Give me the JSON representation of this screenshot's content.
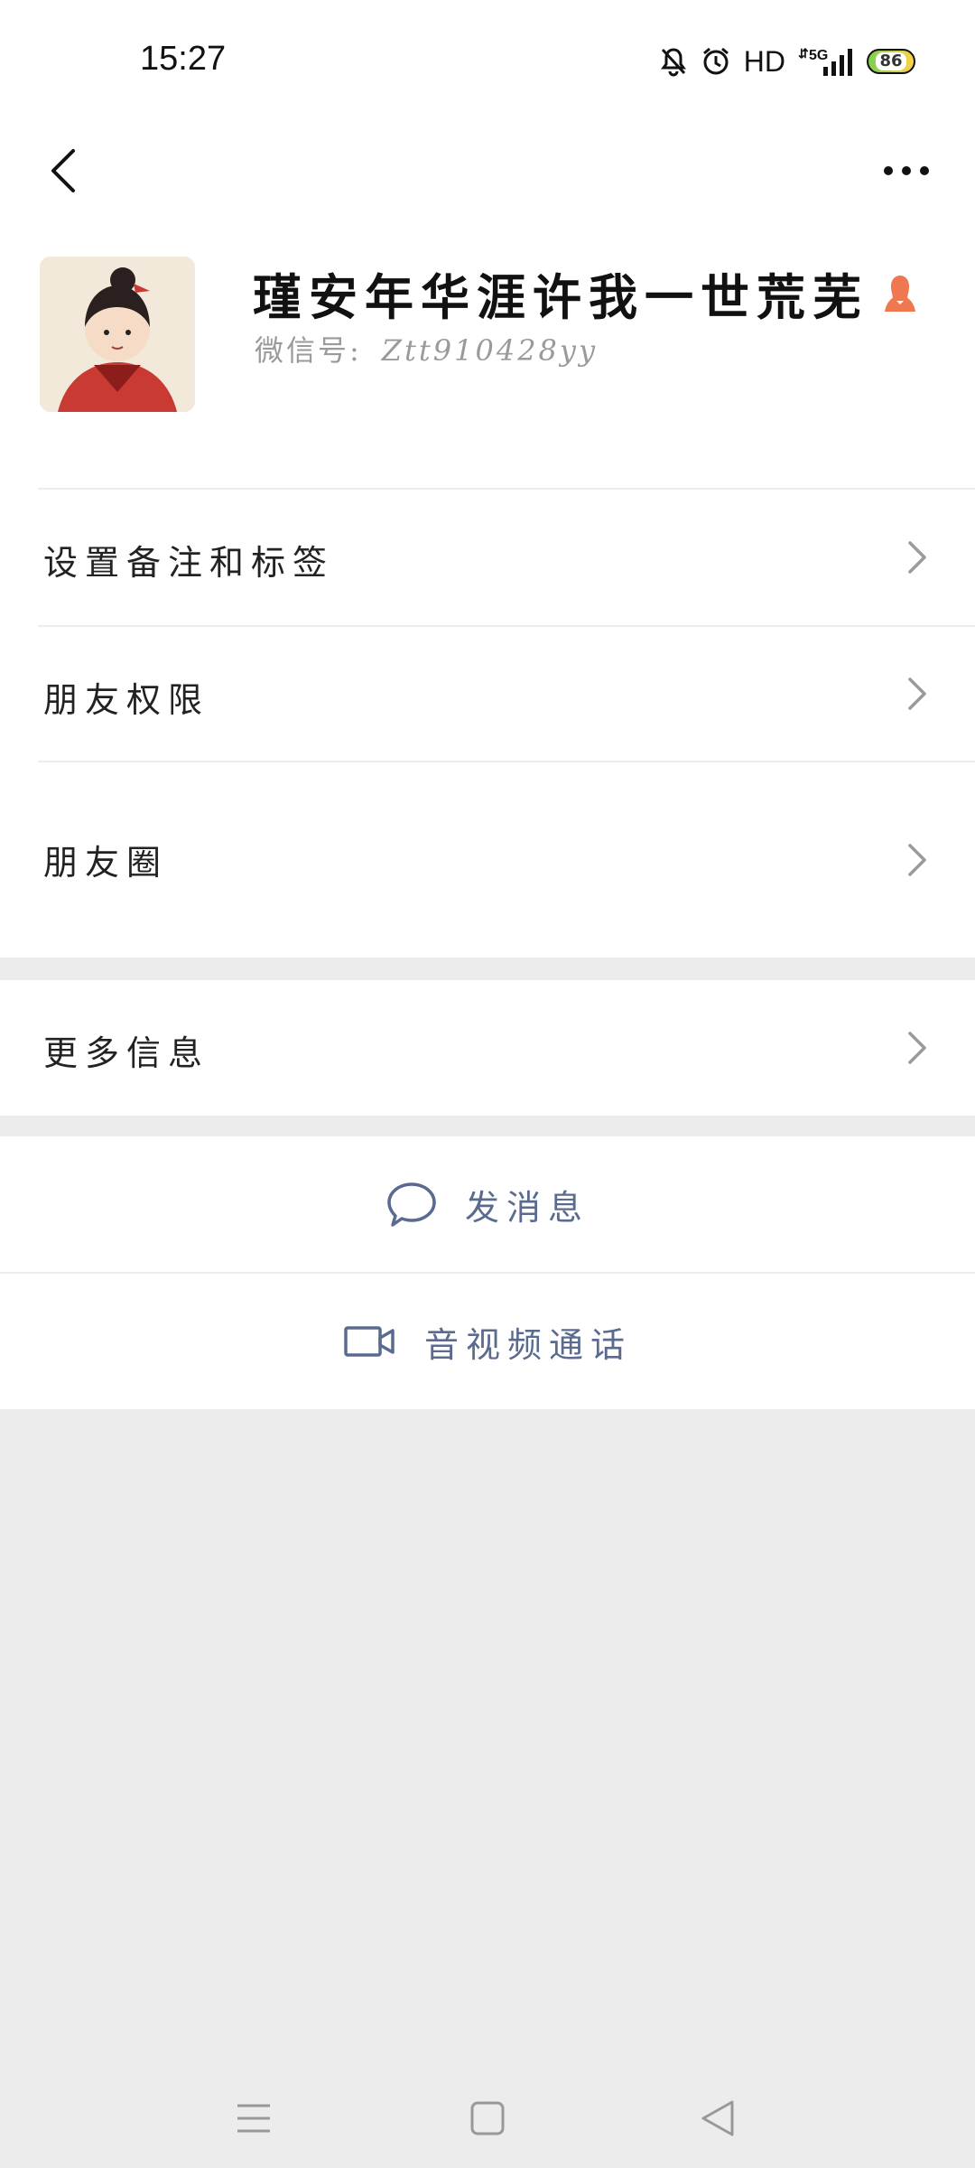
{
  "status_bar": {
    "time": "15:27",
    "hd": "HD",
    "network": "5G",
    "battery": "86",
    "icons": [
      "mute-bell-icon",
      "alarm-clock-icon",
      "signal-icon",
      "battery-icon"
    ]
  },
  "nav": {
    "back_icon": "chevron-left-icon",
    "more_icon": "ellipsis-icon"
  },
  "profile": {
    "name": "瑾安年华涯许我一世荒芜",
    "gender_icon": "female-icon",
    "wechat_id_label": "微信号:",
    "wechat_id": "Ztt910428yy",
    "avatar_icon": "avatar-illustration"
  },
  "menu": {
    "remark_tags": "设置备注和标签",
    "friend_permissions": "朋友权限",
    "moments": "朋友圈",
    "more_info": "更多信息"
  },
  "actions": {
    "send_message": "发消息",
    "video_call": "音视频通话"
  },
  "colors": {
    "action_text": "#5a6b8f",
    "gender_icon": "#f07850",
    "background": "#ececec"
  },
  "system_nav": {
    "icons": [
      "menu-icon",
      "home-square-icon",
      "back-triangle-icon"
    ]
  }
}
